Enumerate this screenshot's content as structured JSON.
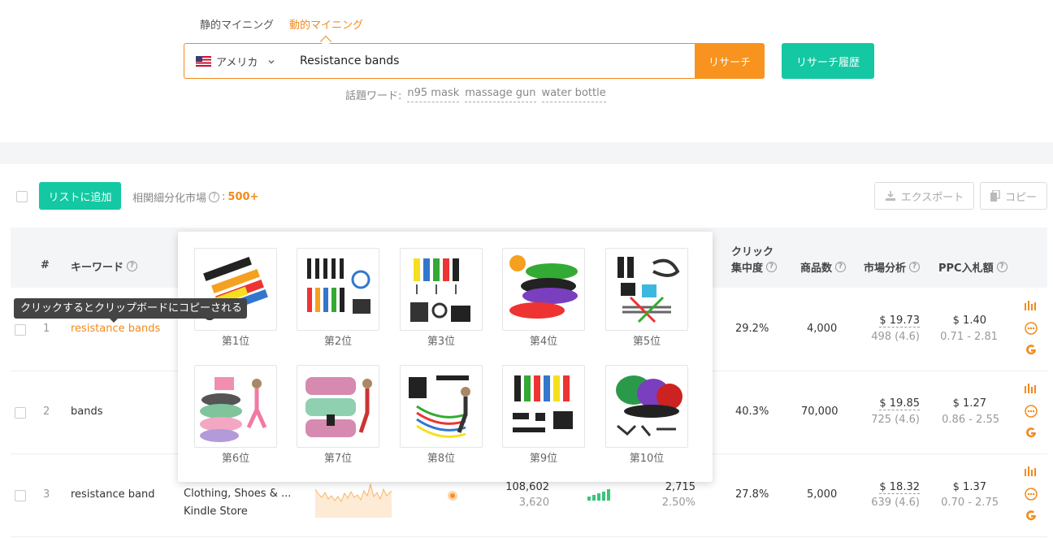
{
  "mode_tabs": {
    "static": "静的マイニング",
    "dynamic": "動的マイニング"
  },
  "search": {
    "country": "アメリカ",
    "query": "Resistance bands",
    "button": "リサーチ"
  },
  "history_button": "リサーチ履歴",
  "hot_words": {
    "label": "話題ワード:",
    "items": [
      "n95 mask",
      "massage gun",
      "water bottle"
    ]
  },
  "toolbar": {
    "add_to_list": "リストに追加",
    "related_label": "相関細分化市場",
    "related_count": "500+",
    "export": "エクスポート",
    "copy": "コピー"
  },
  "headers": {
    "index": "#",
    "keyword": "キーワード",
    "click": "クリック",
    "concentration": "集中度",
    "products": "商品数",
    "market": "市場分析",
    "ppc": "PPC入札額"
  },
  "tooltip": "クリックするとクリップボードにコピーされる",
  "popover": {
    "ranks": [
      "第1位",
      "第2位",
      "第3位",
      "第4位",
      "第5位",
      "第6位",
      "第7位",
      "第8位",
      "第9位",
      "第10位"
    ]
  },
  "rows": [
    {
      "index": "1",
      "keyword": "resistance bands",
      "concentration": "29.2%",
      "products": "4,000",
      "price": "$ 19.73",
      "reviews": "498 (4.6)",
      "ppc": "$ 1.40",
      "ppc_range": "0.71 - 2.81"
    },
    {
      "index": "2",
      "keyword": "bands",
      "concentration": "40.3%",
      "products": "70,000",
      "price": "$ 19.85",
      "reviews": "725 (4.6)",
      "ppc": "$ 1.27",
      "ppc_range": "0.86 - 2.55"
    },
    {
      "index": "3",
      "keyword": "resistance band",
      "category1": "Clothing, Shoes & ...",
      "category2": "Kindle Store",
      "search_volume": "108,602",
      "search_sub": "3,620",
      "clicks": "2,715",
      "click_pct": "2.50%",
      "concentration": "27.8%",
      "products": "5,000",
      "price": "$ 18.32",
      "reviews": "639 (4.6)",
      "ppc": "$ 1.37",
      "ppc_range": "0.70 - 2.75"
    }
  ],
  "colors": {
    "accent": "#f28a1b",
    "primary": "#14c8a3",
    "bar": "#3cc47c"
  }
}
